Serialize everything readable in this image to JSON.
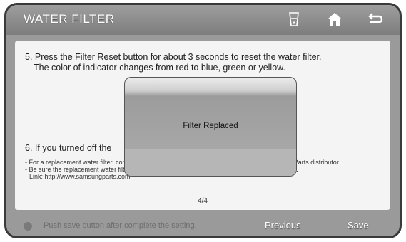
{
  "header": {
    "title": "WATER FILTER",
    "icons": [
      "water-filter-icon",
      "home-icon",
      "back-icon"
    ]
  },
  "content": {
    "step5_line1": "5. Press the Filter Reset button for about 3 seconds to reset the water filter.",
    "step5_line2": "The color of indicator changes from red to blue, green or yellow.",
    "step6": "6. If you turned off the",
    "note1": "- For a replacement water filter, contact your nearest Samsung dealer or contact the Samsung Parts distributor.",
    "note2": "- Be sure the replacement water filter has the SAMSUNG logo on the box and on the water filter.",
    "note3": "Link: http://www.samsungparts.com",
    "page_indicator": "4/4"
  },
  "popup": {
    "message": "Filter Replaced"
  },
  "footer": {
    "message": "Push save button after complete the setting.",
    "previous_label": "Previous",
    "save_label": "Save"
  }
}
